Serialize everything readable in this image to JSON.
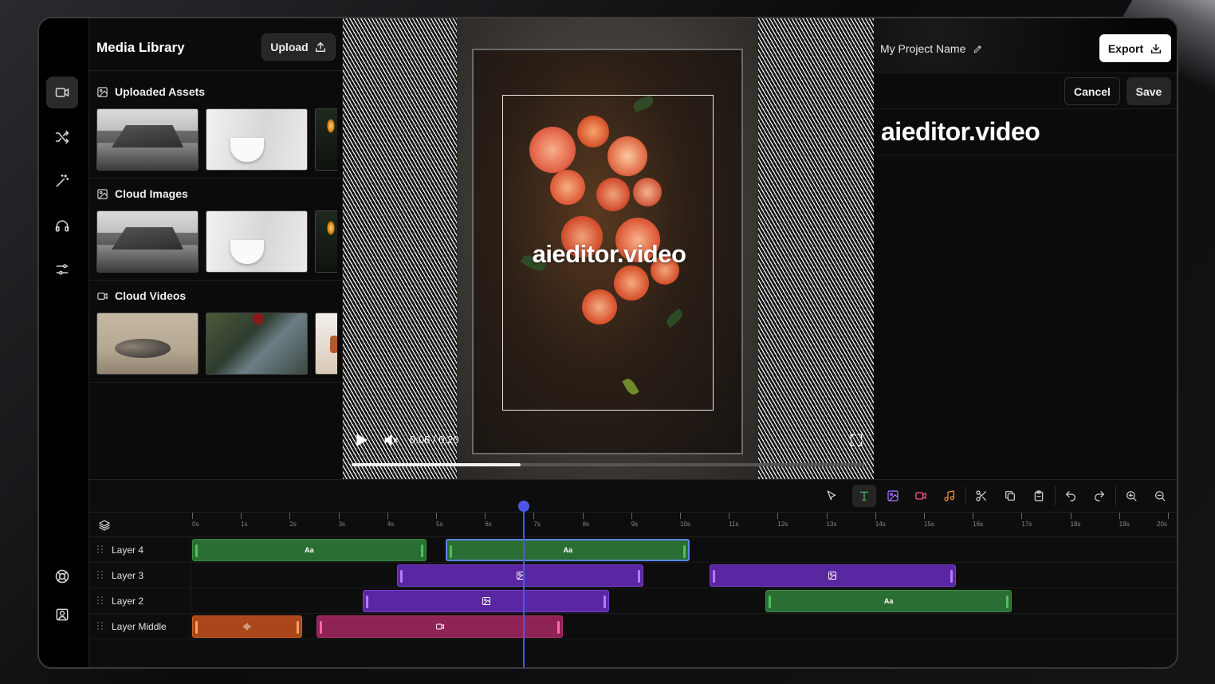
{
  "media_library": {
    "title": "Media Library",
    "upload_label": "Upload",
    "sections": [
      {
        "title": "Uploaded Assets",
        "icon": "image-icon"
      },
      {
        "title": "Cloud Images",
        "icon": "image-icon"
      },
      {
        "title": "Cloud Videos",
        "icon": "video-icon"
      }
    ]
  },
  "sidebar": {
    "items": [
      {
        "name": "video-icon",
        "active": true
      },
      {
        "name": "shuffle-icon",
        "active": false
      },
      {
        "name": "magic-wand-icon",
        "active": false
      },
      {
        "name": "headphones-icon",
        "active": false
      },
      {
        "name": "sliders-icon",
        "active": false
      }
    ],
    "bottom": [
      {
        "name": "help-icon"
      },
      {
        "name": "account-icon"
      }
    ]
  },
  "preview": {
    "overlay_text": "aieditor.video",
    "time": "0:06 / 0:20",
    "progress": 0.33
  },
  "header": {
    "project_name": "My Project Name",
    "export_label": "Export",
    "cancel_label": "Cancel",
    "save_label": "Save"
  },
  "properties": {
    "text_value": "aieditor.video"
  },
  "timeline": {
    "ticks": [
      "0s",
      "1s",
      "2s",
      "3s",
      "4s",
      "5s",
      "6s",
      "7s",
      "8s",
      "9s",
      "10s",
      "11s",
      "12s",
      "13s",
      "14s",
      "15s",
      "16s",
      "17s",
      "18s",
      "19s",
      "20s"
    ],
    "playhead_seconds": 6.8,
    "tracks": [
      {
        "label": "Layer 4",
        "clips": [
          {
            "type": "text",
            "start": 0.0,
            "end": 4.8,
            "label": "Aa",
            "selected": false
          },
          {
            "type": "text",
            "start": 5.2,
            "end": 10.2,
            "label": "Aa",
            "selected": true
          }
        ]
      },
      {
        "label": "Layer 3",
        "clips": [
          {
            "type": "image",
            "start": 4.2,
            "end": 9.25,
            "label": ""
          },
          {
            "type": "image",
            "start": 10.6,
            "end": 15.65,
            "label": ""
          }
        ]
      },
      {
        "label": "Layer 2",
        "clips": [
          {
            "type": "image",
            "start": 3.5,
            "end": 8.55,
            "label": ""
          },
          {
            "type": "text",
            "start": 11.75,
            "end": 16.8,
            "label": "Aa",
            "selected": false
          }
        ]
      },
      {
        "label": "Layer Middle",
        "clips": [
          {
            "type": "audio",
            "start": 0.0,
            "end": 2.25,
            "label": ""
          },
          {
            "type": "video",
            "start": 2.55,
            "end": 7.6,
            "label": ""
          }
        ]
      }
    ]
  },
  "colors": {
    "accent_playhead": "#4e56e8",
    "text_clip": "#2b6e33",
    "image_clip": "#5a27a3",
    "video_clip": "#8e2456",
    "audio_clip": "#a9471a"
  }
}
